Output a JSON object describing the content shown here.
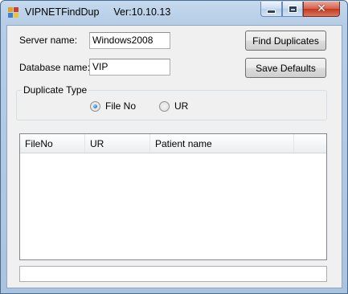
{
  "window": {
    "title": "VIPNETFindDup",
    "version": "Ver:10.10.13",
    "icon": "app-icon",
    "controls": {
      "minimize": "minimize-icon",
      "maximize": "maximize-icon",
      "close": "close-icon"
    }
  },
  "form": {
    "server_label": "Server name:",
    "server_value": "Windows2008",
    "database_label": "Database name:",
    "database_value": "VIP",
    "find_button": "Find Duplicates",
    "save_button": "Save Defaults"
  },
  "duplicate_type": {
    "title": "Duplicate Type",
    "options": [
      {
        "label": "File No",
        "selected": true
      },
      {
        "label": "UR",
        "selected": false
      }
    ]
  },
  "results": {
    "columns": [
      "FileNo",
      "UR",
      "Patient name"
    ],
    "rows": []
  },
  "status": {
    "text": ""
  },
  "colors": {
    "title_bar": "#b6cde6",
    "client_bg": "#f0f0f0",
    "close_button": "#c2391f",
    "radio_selected": "#0d5aa7"
  }
}
